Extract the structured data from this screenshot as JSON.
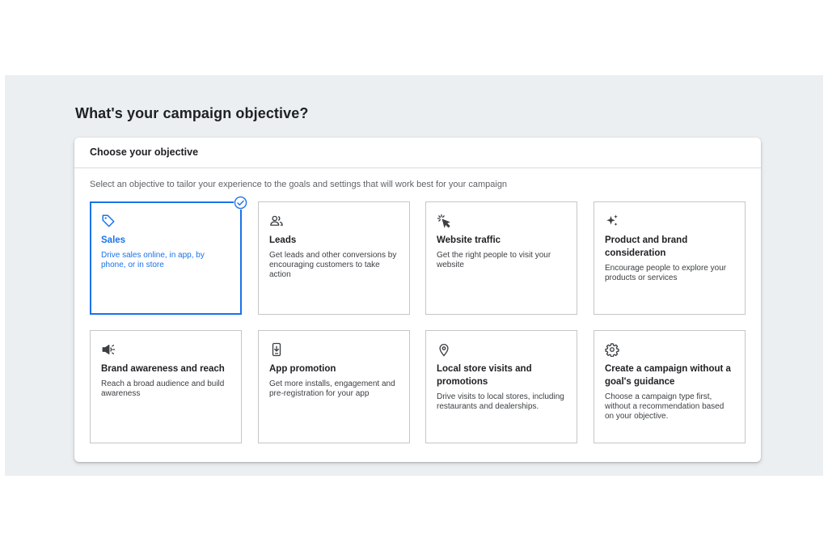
{
  "page": {
    "title": "What's your campaign objective?"
  },
  "card": {
    "header": "Choose your objective",
    "subtitle": "Select an objective to tailor your experience to the goals and settings that will work best for your campaign"
  },
  "objectives": [
    {
      "title": "Sales",
      "description": "Drive sales online, in app, by phone, or in store",
      "icon": "tag-icon",
      "selected": true
    },
    {
      "title": "Leads",
      "description": "Get leads and other conversions by encouraging customers to take action",
      "icon": "people-icon",
      "selected": false
    },
    {
      "title": "Website traffic",
      "description": "Get the right people to visit your website",
      "icon": "cursor-click-icon",
      "selected": false
    },
    {
      "title": "Product and brand consideration",
      "description": "Encourage people to explore your products or services",
      "icon": "sparkle-icon",
      "selected": false
    },
    {
      "title": "Brand awareness and reach",
      "description": "Reach a broad audience and build awareness",
      "icon": "megaphone-icon",
      "selected": false
    },
    {
      "title": "App promotion",
      "description": "Get more installs, engagement and pre-registration for your app",
      "icon": "phone-download-icon",
      "selected": false
    },
    {
      "title": "Local store visits and promotions",
      "description": "Drive visits to local stores, including restaurants and dealerships.",
      "icon": "location-pin-icon",
      "selected": false
    },
    {
      "title": "Create a campaign without a goal's guidance",
      "description": "Choose a campaign type first, without a recommendation based on your objective.",
      "icon": "gear-icon",
      "selected": false
    }
  ],
  "colors": {
    "accent": "#1a73e8",
    "background": "#eceff1",
    "border": "#c4c7c5",
    "text": "#202124"
  }
}
